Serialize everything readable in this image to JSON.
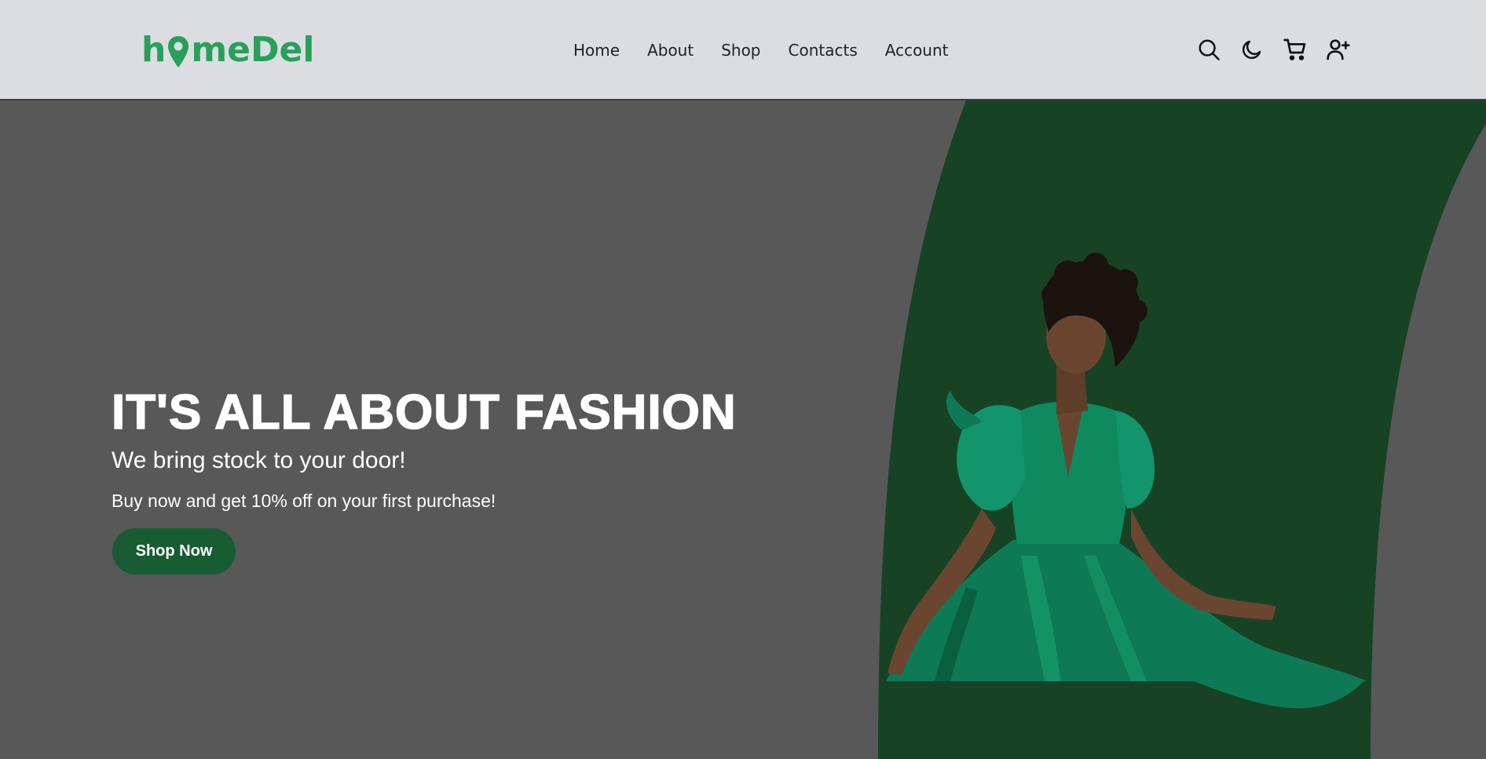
{
  "brand": {
    "logo_prefix": "h",
    "logo_suffix": "meDel",
    "logo_pin_icon": "map-pin-icon",
    "color": "#27a05a"
  },
  "nav": {
    "links": [
      "Home",
      "About",
      "Shop",
      "Contacts",
      "Account"
    ],
    "icons": [
      "search-icon",
      "moon-icon",
      "cart-icon",
      "user-plus-icon"
    ]
  },
  "hero": {
    "title": "IT'S ALL ABOUT FASHION",
    "subtitle": "We bring stock to your door!",
    "offer": "Buy now and get 10% off on your first purchase!",
    "cta_label": "Shop Now",
    "image_description": "woman-in-green-dress",
    "colors": {
      "background": "#585858",
      "arch": "#174324",
      "button": "#185c33",
      "dress": "#0e7a55"
    }
  }
}
